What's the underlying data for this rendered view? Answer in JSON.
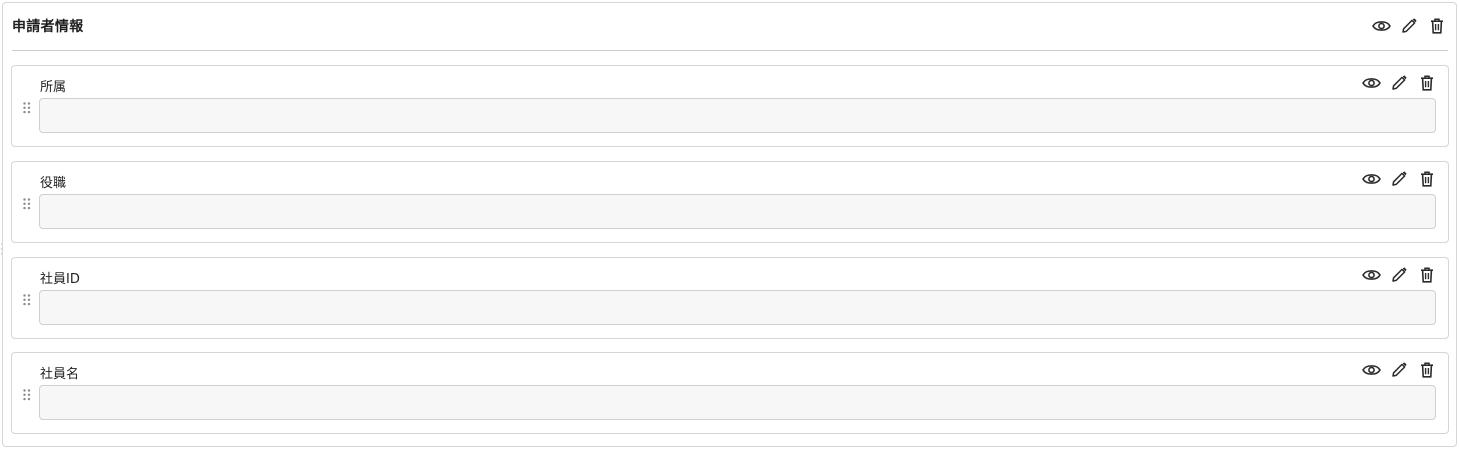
{
  "section": {
    "title": "申請者情報",
    "actions": [
      "eye-icon",
      "pencil-icon",
      "trash-icon"
    ]
  },
  "fields": [
    {
      "label": "所属",
      "value": "",
      "placeholder": ""
    },
    {
      "label": "役職",
      "value": "",
      "placeholder": ""
    },
    {
      "label": "社員ID",
      "value": "",
      "placeholder": ""
    },
    {
      "label": "社員名",
      "value": "",
      "placeholder": ""
    }
  ],
  "colors": {
    "border": "#d6d6d6",
    "input_bg": "#f7f7f7",
    "icon": "#2b2b2b",
    "handle": "#8a8a8a"
  }
}
